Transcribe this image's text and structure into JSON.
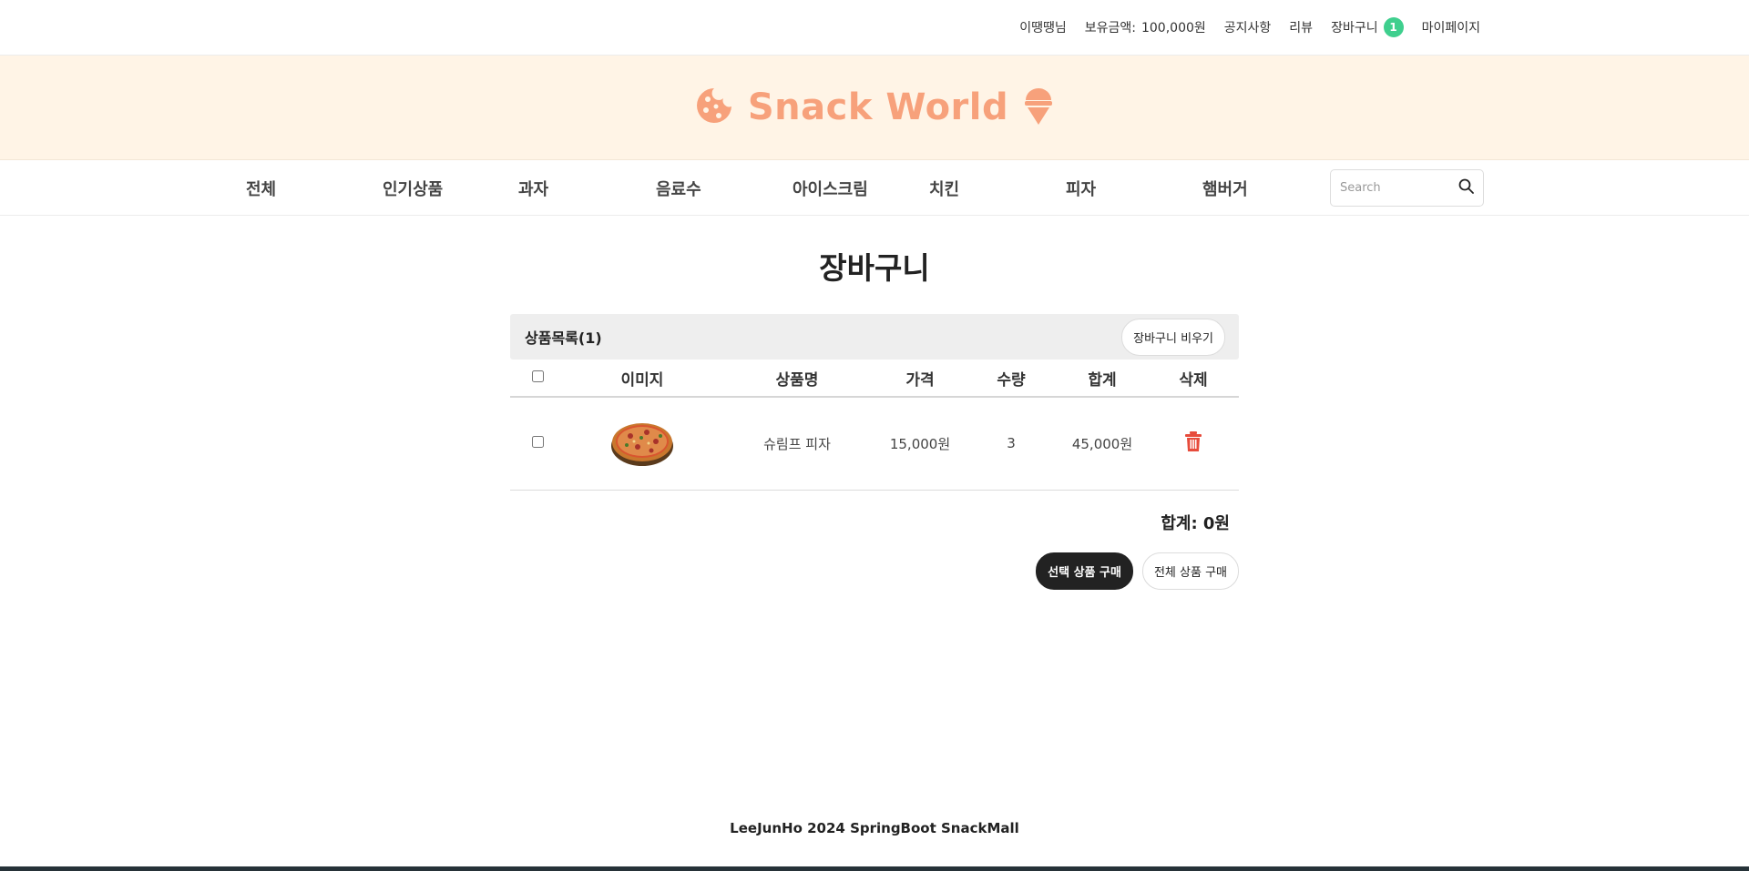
{
  "topnav": {
    "user": "이땡땡님",
    "balance_label": "보유금액:",
    "balance_value": "100,000원",
    "notice": "공지사항",
    "review": "리뷰",
    "cart": "장바구니",
    "cart_count": "1",
    "mypage": "마이페이지"
  },
  "banner": {
    "title": "Snack World",
    "left_icon": "cookie-icon",
    "right_icon": "ice-cream-icon",
    "color": "#f7a17b"
  },
  "categories": [
    "전체",
    "인기상품",
    "과자",
    "음료수",
    "아이스크림",
    "치킨",
    "피자",
    "햄버거"
  ],
  "search": {
    "placeholder": "Search"
  },
  "page": {
    "title": "장바구니"
  },
  "cart": {
    "list_label": "상품목록(1)",
    "clear_button": "장바구니 비우기",
    "columns": [
      "이미지",
      "상품명",
      "가격",
      "수량",
      "합계",
      "삭제"
    ],
    "items": [
      {
        "name": "슈림프 피자",
        "price": "15,000원",
        "qty": "3",
        "sum": "45,000원",
        "image": "pizza"
      }
    ],
    "total": "합계: 0원",
    "buy_selected": "선택 상품 구매",
    "buy_all": "전체 상품 구매"
  },
  "footer": {
    "text": "LeeJunHo 2024 SpringBoot SnackMall"
  },
  "colors": {
    "accent": "#f7a17b",
    "banner_bg": "#fff4e6",
    "badge": "#3fcf8e",
    "delete": "#e74c3c"
  }
}
